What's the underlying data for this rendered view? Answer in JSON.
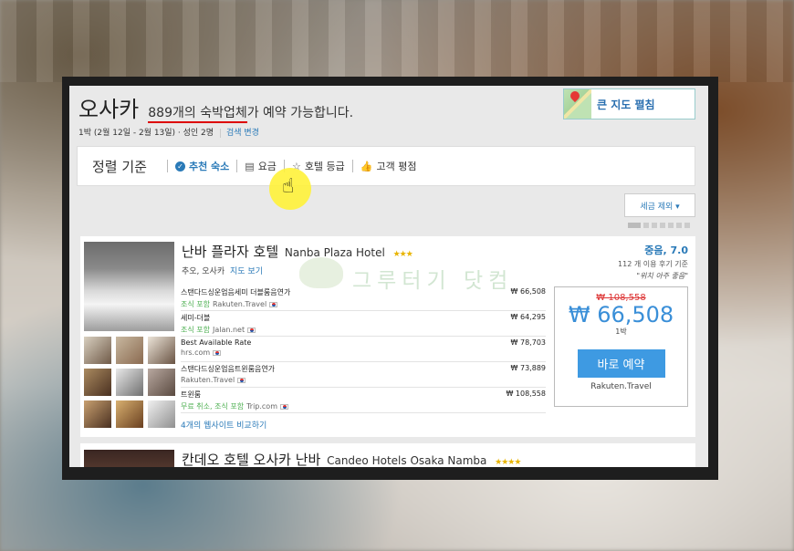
{
  "search": {
    "city": "오사카",
    "count_number": "889",
    "count_word1": "개의 숙박업체",
    "count_rest": "가 예약 가능합니다.",
    "stay_info": "1박 (2월 12일 - 2월 13일) · 성인 2명",
    "change_search": "검색 변경"
  },
  "map": {
    "label": "큰 지도 펼침",
    "icon": "map-pin-icon"
  },
  "sort": {
    "title": "정렬 기준",
    "items": [
      {
        "label": "추천 숙소",
        "icon": "check-circle-icon",
        "active": true
      },
      {
        "label": "요금",
        "icon": "money-icon",
        "active": false
      },
      {
        "label": "호텔 등급",
        "icon": "star-outline-icon",
        "active": false
      },
      {
        "label": "고객 평점",
        "icon": "thumbs-up-icon",
        "active": false
      }
    ]
  },
  "tax_toggle": {
    "label": "세금 제외 ▾"
  },
  "hotel1": {
    "name_ko": "난바 플라자 호텔",
    "name_en": "Nanba Plaza Hotel",
    "stars": 3,
    "stars_text": "★★★",
    "location": "추오, 오사카",
    "map_link": "지도 보기",
    "rating_score": "중음, 7.0",
    "rating_count": "112 개 이용 후기 기준",
    "rating_quote": "\"위치 아주 좋음\"",
    "deals": [
      {
        "name": "스탠다드싱운업음세미 더블룸음연가",
        "tag": "조식 포함",
        "site": "Rakuten.Travel",
        "price": "₩ 66,508"
      },
      {
        "name": "세미-더블",
        "tag": "조식 포함",
        "site": "Jalan.net",
        "price": "₩ 64,295"
      },
      {
        "name": "Best Available Rate",
        "tag": "",
        "site": "hrs.com",
        "price": "₩ 78,703"
      },
      {
        "name": "스탠다드싱운업음트윈룸음연가",
        "tag": "",
        "site": "Rakuten.Travel",
        "price": "₩ 73,889"
      },
      {
        "name": "트윈룸",
        "tag": "무료 취소, 조식 포함",
        "site": "Trip.com",
        "price": "₩ 108,558"
      }
    ],
    "compare_link": "4개의 웹사이트 비교하기",
    "old_price": "₩ 108,558",
    "price": "₩ 66,508",
    "per_night": "1박",
    "book_label": "바로 예약",
    "book_site": "Rakuten.Travel"
  },
  "watermark": "그루터기 닷컴",
  "hotel2": {
    "name_ko": "칸데오 호텔 오사카 난바",
    "name_en": "Candeo Hotels Osaka Namba",
    "stars_text": "★★★★"
  }
}
